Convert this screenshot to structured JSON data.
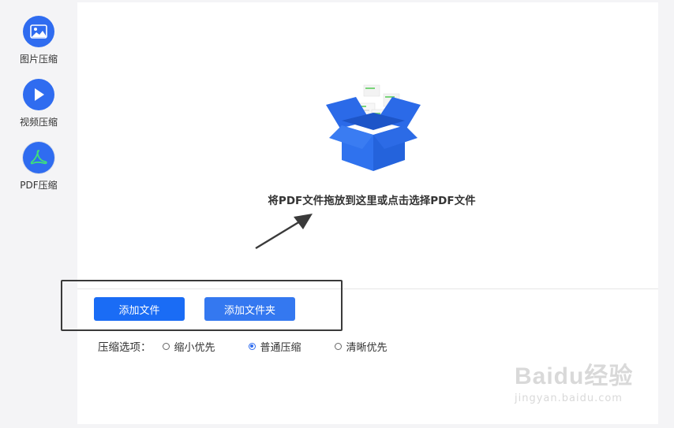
{
  "sidebar": {
    "items": [
      {
        "label": "图片压缩",
        "icon": "image-icon"
      },
      {
        "label": "视频压缩",
        "icon": "play-icon"
      },
      {
        "label": "PDF压缩",
        "icon": "pdf-icon"
      }
    ],
    "active_index": 2
  },
  "drop_zone": {
    "hint": "将PDF文件拖放到这里或点击选择PDF文件",
    "illustration_icon": "open-box-icon"
  },
  "buttons": {
    "add_file": "添加文件",
    "add_folder": "添加文件夹"
  },
  "compression": {
    "label": "压缩选项：",
    "options": [
      {
        "label": "缩小优先",
        "checked": false
      },
      {
        "label": "普通压缩",
        "checked": true
      },
      {
        "label": "清晰优先",
        "checked": false
      }
    ]
  },
  "watermark": {
    "logo": "Baidu经验",
    "url": "jingyan.baidu.com"
  },
  "colors": {
    "accent": "#2f6cf0",
    "button": "#1a6cf5",
    "sidebar_bg": "#f4f4f6"
  }
}
